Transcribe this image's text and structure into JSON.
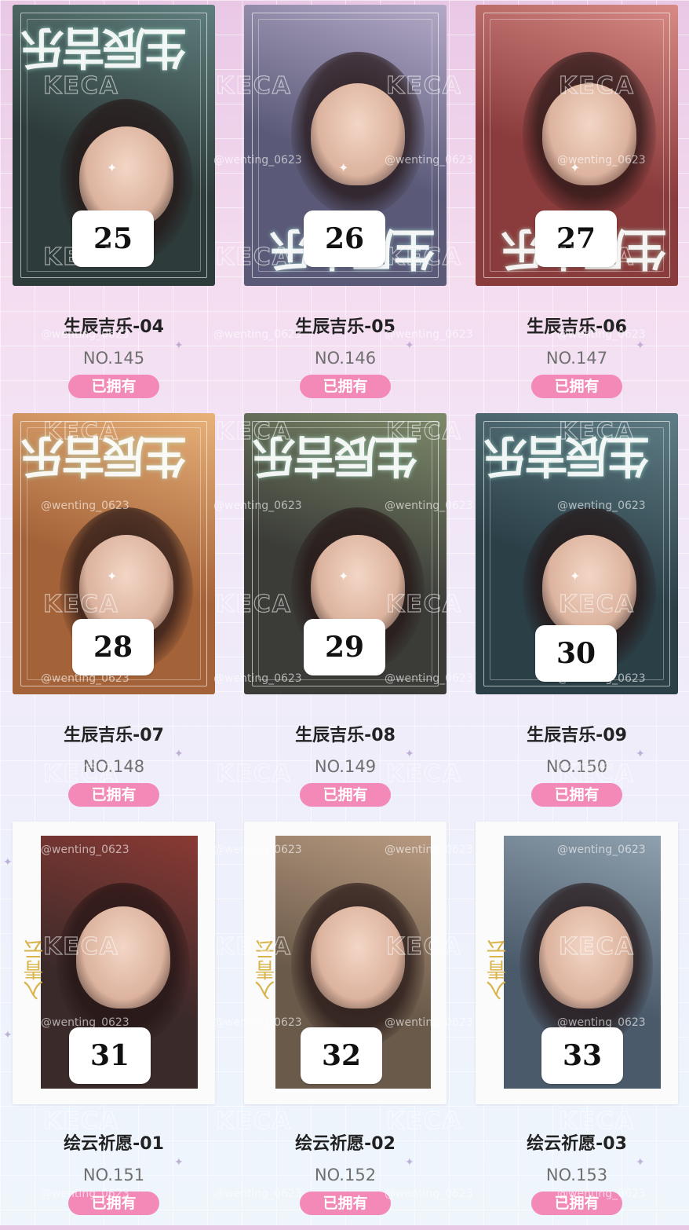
{
  "cards": [
    {
      "number": "25",
      "name": "生辰吉乐-04",
      "no": "NO.145",
      "status": "已拥有",
      "title_art": "生辰吉乐",
      "theme": "#2d3b3a",
      "theme2": "#5f7f7e"
    },
    {
      "number": "26",
      "name": "生辰吉乐-05",
      "no": "NO.146",
      "status": "已拥有",
      "title_art": "生辰吉乐",
      "theme": "#5a5a78",
      "theme2": "#b4aac8"
    },
    {
      "number": "27",
      "name": "生辰吉乐-06",
      "no": "NO.147",
      "status": "已拥有",
      "title_art": "生辰吉乐",
      "theme": "#8a3b3b",
      "theme2": "#d88a86"
    },
    {
      "number": "28",
      "name": "生辰吉乐-07",
      "no": "NO.148",
      "status": "已拥有",
      "title_art": "生辰吉乐",
      "theme": "#a46238",
      "theme2": "#e9b27a"
    },
    {
      "number": "29",
      "name": "生辰吉乐-08",
      "no": "NO.149",
      "status": "已拥有",
      "title_art": "生辰吉乐",
      "theme": "#3b3c38",
      "theme2": "#7d8a6a"
    },
    {
      "number": "30",
      "name": "生辰吉乐-09",
      "no": "NO.150",
      "status": "已拥有",
      "title_art": "生辰吉乐",
      "theme": "#2b3f47",
      "theme2": "#5f7d86"
    },
    {
      "number": "31",
      "name": "绘云祈愿-01",
      "no": "NO.151",
      "status": "已拥有",
      "title_art": "入青云",
      "theme": "#3b2a2a",
      "theme2": "#8a3a34"
    },
    {
      "number": "32",
      "name": "绘云祈愿-02",
      "no": "NO.152",
      "status": "已拥有",
      "title_art": "入青云",
      "theme": "#6a5a4a",
      "theme2": "#b89a80"
    },
    {
      "number": "33",
      "name": "绘云祈愿-03",
      "no": "NO.153",
      "status": "已拥有",
      "title_art": "入青云",
      "theme": "#4a5a6a",
      "theme2": "#8fa0ae"
    }
  ],
  "watermark": {
    "logo": "KECA",
    "handle": "@wenting_0623"
  }
}
